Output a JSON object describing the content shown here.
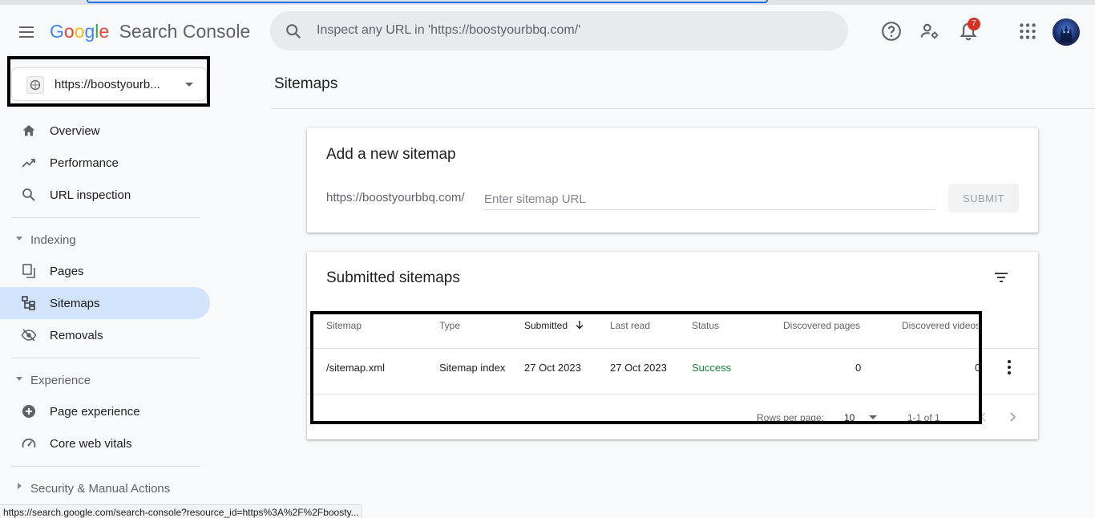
{
  "header": {
    "logo_google": "Google",
    "product": "Search Console",
    "search_placeholder": "Inspect any URL in 'https://boostyourbbq.com/'",
    "notification_count": "7"
  },
  "sidebar": {
    "property_url": "https://boostyourb...",
    "items": [
      {
        "label": "Overview",
        "icon": "home-icon"
      },
      {
        "label": "Performance",
        "icon": "trending-up-icon"
      },
      {
        "label": "URL inspection",
        "icon": "search-icon"
      }
    ],
    "sections": {
      "indexing": {
        "label": "Indexing",
        "items": [
          {
            "label": "Pages",
            "icon": "pages-icon"
          },
          {
            "label": "Sitemaps",
            "icon": "sitemap-icon",
            "active": true
          },
          {
            "label": "Removals",
            "icon": "visibility-off-icon"
          }
        ]
      },
      "experience": {
        "label": "Experience",
        "items": [
          {
            "label": "Page experience",
            "icon": "add-circle-icon"
          },
          {
            "label": "Core web vitals",
            "icon": "speed-gauge-icon"
          }
        ]
      },
      "security": {
        "label": "Security & Manual Actions"
      }
    }
  },
  "main": {
    "page_title": "Sitemaps",
    "add_card": {
      "title": "Add a new sitemap",
      "prefix": "https://boostyourbbq.com/",
      "input_placeholder": "Enter sitemap URL",
      "submit_label": "SUBMIT"
    },
    "submitted_card": {
      "title": "Submitted sitemaps",
      "columns": [
        "Sitemap",
        "Type",
        "Submitted",
        "Last read",
        "Status",
        "Discovered pages",
        "Discovered videos"
      ],
      "rows": [
        {
          "sitemap": "/sitemap.xml",
          "type": "Sitemap index",
          "submitted": "27 Oct 2023",
          "last_read": "27 Oct 2023",
          "status": "Success",
          "discovered_pages": "0",
          "discovered_videos": "0"
        }
      ],
      "pagination": {
        "rows_per_page_label": "Rows per page:",
        "rows_per_page": "10",
        "range": "1-1 of 1"
      }
    }
  },
  "status_bar": {
    "url": "https://search.google.com/search-console?resource_id=https%3A%2F%2Fboosty..."
  },
  "colors": {
    "accent": "#1a73e8",
    "active_nav": "#d2e3fc",
    "success": "#188038",
    "badge": "#d93025"
  }
}
